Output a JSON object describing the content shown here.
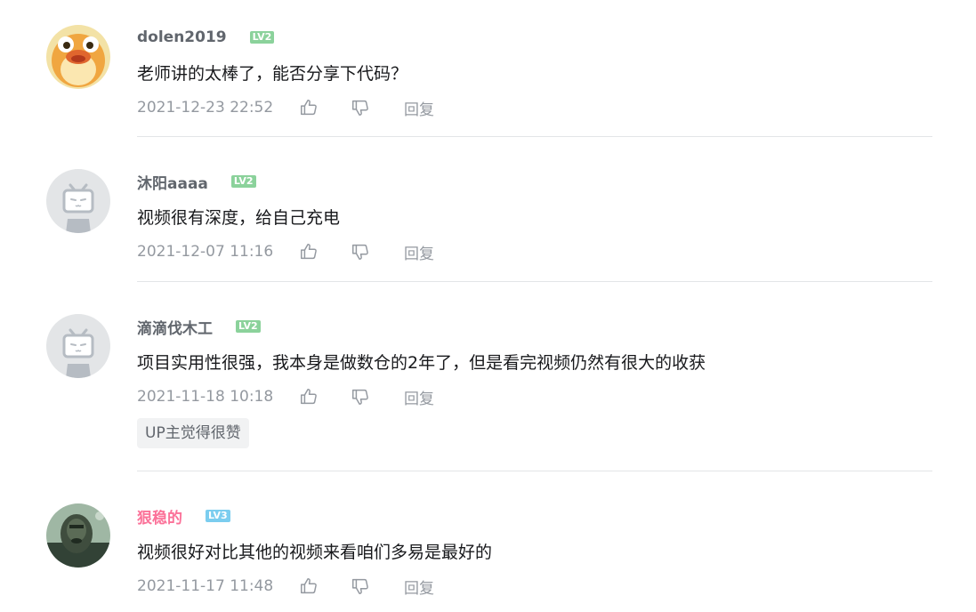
{
  "comments": [
    {
      "username": "dolen2019",
      "level": "LV2",
      "content": "老师讲的太棒了，能否分享下代码？",
      "time": "2021-12-23 22:52",
      "reply_label": "回复",
      "avatar": "duck-avatar"
    },
    {
      "username": "沐阳aaaa",
      "level": "LV2",
      "content": "视频很有深度，给自己充电",
      "time": "2021-12-07 11:16",
      "reply_label": "回复",
      "avatar": "default-tv-avatar"
    },
    {
      "username": "滴滴伐木工",
      "level": "LV2",
      "content": "项目实用性很强，我本身是做数仓的2年了，但是看完视频仍然有很大的收获",
      "time": "2021-11-18 10:18",
      "reply_label": "回复",
      "up_badge": "UP主觉得很赞",
      "avatar": "default-tv-avatar"
    },
    {
      "username": "狠稳的",
      "level": "LV3",
      "content": "视频很好对比其他的视频来看咱们多易是最好的",
      "time": "2021-11-17 11:48",
      "reply_label": "回复",
      "avatar": "photo-avatar"
    }
  ],
  "colors": {
    "username": "#61666d",
    "username_vip": "#fb7299",
    "lv2": "#8bd29b",
    "lv3": "#7bcdef",
    "meta": "#9499a0",
    "divider": "#e3e5e7"
  }
}
